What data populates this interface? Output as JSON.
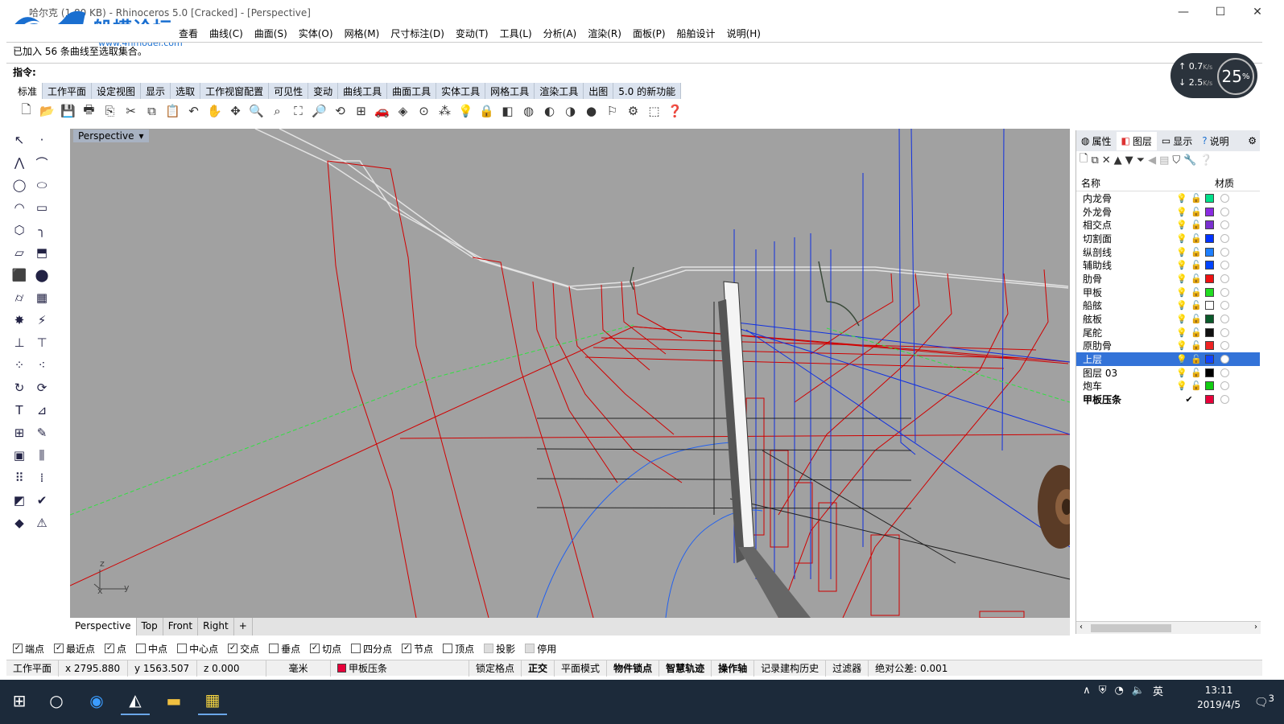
{
  "window": {
    "title": "哈尔克 (1.80 KB) - Rhinoceros 5.0 [Cracked] - [Perspective]",
    "controls": [
      "—",
      "☐",
      "✕"
    ]
  },
  "logo": {
    "name": "船模论坛",
    "url": "www.4hmodel.com"
  },
  "menu": [
    "查看",
    "曲线(C)",
    "曲面(S)",
    "实体(O)",
    "网格(M)",
    "尺寸标注(D)",
    "变动(T)",
    "工具(L)",
    "分析(A)",
    "渲染(R)",
    "面板(P)",
    "船舶设计",
    "说明(H)"
  ],
  "command": {
    "history": "已加入 56 条曲线至选取集合。",
    "prompt": "指令:"
  },
  "network": {
    "up": "0.7",
    "up_unit": "K/s",
    "down": "2.5",
    "down_unit": "K/s",
    "percent": "25",
    "percent_unit": "%"
  },
  "toolbar_tabs": [
    "标准",
    "工作平面",
    "设定视图",
    "显示",
    "选取",
    "工作视窗配置",
    "可见性",
    "变动",
    "曲线工具",
    "曲面工具",
    "实体工具",
    "网格工具",
    "渲染工具",
    "出图",
    "5.0 的新功能"
  ],
  "viewport": {
    "label": "Perspective",
    "tabs": [
      "Perspective",
      "Top",
      "Front",
      "Right",
      "+"
    ]
  },
  "osnaps": [
    {
      "label": "端点",
      "checked": true
    },
    {
      "label": "最近点",
      "checked": true
    },
    {
      "label": "点",
      "checked": true
    },
    {
      "label": "中点",
      "checked": false
    },
    {
      "label": "中心点",
      "checked": false
    },
    {
      "label": "交点",
      "checked": true
    },
    {
      "label": "垂点",
      "checked": false
    },
    {
      "label": "切点",
      "checked": true
    },
    {
      "label": "四分点",
      "checked": false
    },
    {
      "label": "节点",
      "checked": true
    },
    {
      "label": "顶点",
      "checked": false
    },
    {
      "label": "投影",
      "checked": false
    },
    {
      "label": "停用",
      "checked": false
    }
  ],
  "status": {
    "plane": "工作平面",
    "x": "x 2795.880",
    "y": "y 1563.507",
    "z": "z 0.000",
    "unit": "毫米",
    "layer": "甲板压条",
    "layer_color": "#e8003a",
    "gridsnap": "锁定格点",
    "ortho": "正交",
    "planar": "平面模式",
    "osnap": "物件锁点",
    "smarttrack": "智慧轨迹",
    "gumball": "操作轴",
    "history": "记录建构历史",
    "filter": "过滤器",
    "tolerance": "绝对公差: 0.001"
  },
  "panel": {
    "tabs": [
      "属性",
      "图层",
      "显示",
      "说明"
    ],
    "col_name": "名称",
    "col_material": "材质"
  },
  "layers": [
    {
      "name": "内龙骨",
      "color": "#00e08a",
      "selected": false,
      "bold": false
    },
    {
      "name": "外龙骨",
      "color": "#8a2be2",
      "selected": false,
      "bold": false
    },
    {
      "name": "相交点",
      "color": "#7a30d0",
      "selected": false,
      "bold": false
    },
    {
      "name": "切割面",
      "color": "#0033ff",
      "selected": false,
      "bold": false
    },
    {
      "name": "纵剖线",
      "color": "#1e7fff",
      "selected": false,
      "bold": false
    },
    {
      "name": "辅助线",
      "color": "#0044ff",
      "selected": false,
      "bold": false
    },
    {
      "name": "肋骨",
      "color": "#ee1111",
      "selected": false,
      "bold": false
    },
    {
      "name": "甲板",
      "color": "#22dd22",
      "selected": false,
      "bold": false
    },
    {
      "name": "船舷",
      "color": "#ffffff",
      "selected": false,
      "bold": false
    },
    {
      "name": "舷板",
      "color": "#0a5a2a",
      "selected": false,
      "bold": false
    },
    {
      "name": "尾舵",
      "color": "#111111",
      "selected": false,
      "bold": false
    },
    {
      "name": "原肋骨",
      "color": "#ee2222",
      "selected": false,
      "bold": false
    },
    {
      "name": "上层",
      "color": "#1144ff",
      "selected": true,
      "bold": false
    },
    {
      "name": "图层 03",
      "color": "#000000",
      "selected": false,
      "bold": false
    },
    {
      "name": "炮车",
      "color": "#11cc11",
      "selected": false,
      "bold": false
    },
    {
      "name": "甲板压条",
      "color": "#e8003a",
      "selected": false,
      "bold": true
    }
  ],
  "taskbar": {
    "time": "13:11",
    "date": "2019/4/5",
    "ime": "英",
    "notif_count": "3"
  },
  "colors": {
    "viewport_bg": "#a1a1a1",
    "selection": "#3373d8",
    "taskbar": "#1c2a3a"
  }
}
